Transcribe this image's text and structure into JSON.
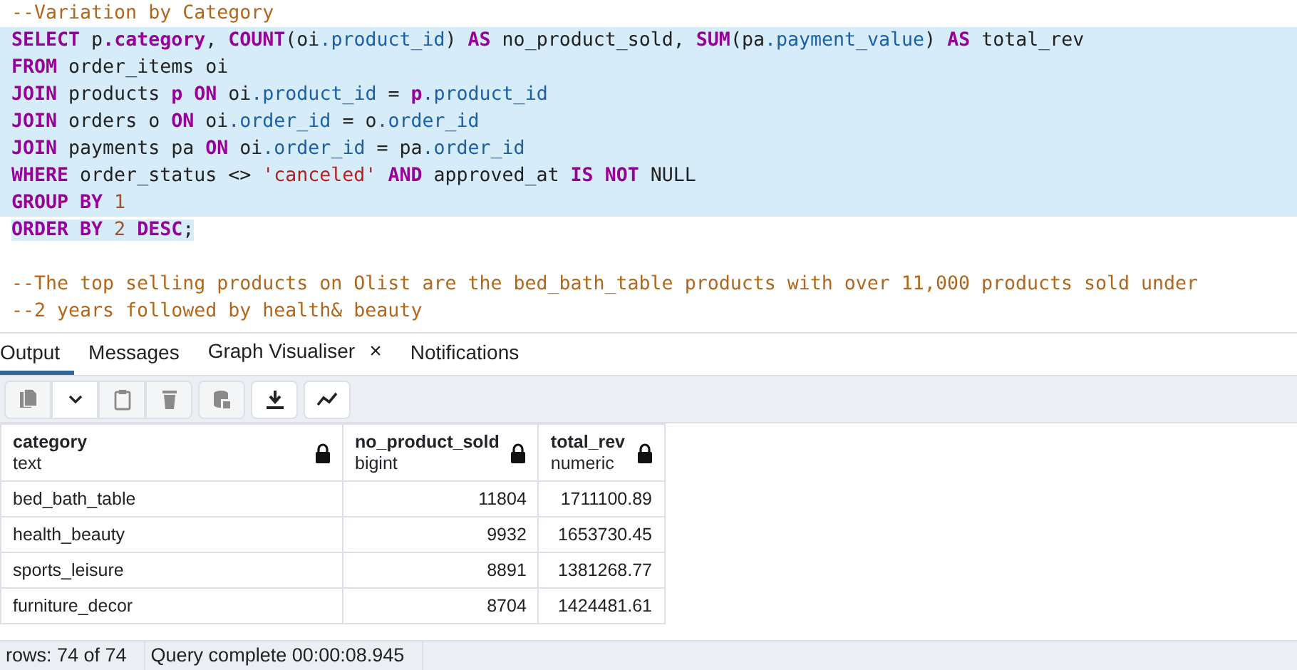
{
  "editor": {
    "lines": [
      {
        "selected": false,
        "tokens": [
          {
            "kind": "comment",
            "text": "--Variation by Category"
          }
        ]
      },
      {
        "selected": true,
        "tokens": [
          {
            "kind": "keyword",
            "text": "SELECT"
          },
          {
            "kind": "plain",
            "text": " p"
          },
          {
            "kind": "keyword",
            "text": ".category"
          },
          {
            "kind": "plain",
            "text": ", "
          },
          {
            "kind": "keyword",
            "text": "COUNT"
          },
          {
            "kind": "plain",
            "text": "(oi"
          },
          {
            "kind": "prop",
            "text": ".product_id"
          },
          {
            "kind": "plain",
            "text": ") "
          },
          {
            "kind": "keyword",
            "text": "AS"
          },
          {
            "kind": "plain",
            "text": " no_product_sold, "
          },
          {
            "kind": "keyword",
            "text": "SUM"
          },
          {
            "kind": "plain",
            "text": "(pa"
          },
          {
            "kind": "prop",
            "text": ".payment_value"
          },
          {
            "kind": "plain",
            "text": ") "
          },
          {
            "kind": "keyword",
            "text": "AS"
          },
          {
            "kind": "plain",
            "text": " total_rev"
          }
        ]
      },
      {
        "selected": true,
        "tokens": [
          {
            "kind": "keyword",
            "text": "FROM"
          },
          {
            "kind": "plain",
            "text": " order_items oi"
          }
        ]
      },
      {
        "selected": true,
        "tokens": [
          {
            "kind": "keyword",
            "text": "JOIN"
          },
          {
            "kind": "plain",
            "text": " products "
          },
          {
            "kind": "keyword",
            "text": "p ON"
          },
          {
            "kind": "plain",
            "text": " oi"
          },
          {
            "kind": "prop",
            "text": ".product_id"
          },
          {
            "kind": "plain",
            "text": " = "
          },
          {
            "kind": "keyword",
            "text": "p"
          },
          {
            "kind": "prop",
            "text": ".product_id"
          }
        ]
      },
      {
        "selected": true,
        "tokens": [
          {
            "kind": "keyword",
            "text": "JOIN"
          },
          {
            "kind": "plain",
            "text": " orders o "
          },
          {
            "kind": "keyword",
            "text": "ON"
          },
          {
            "kind": "plain",
            "text": " oi"
          },
          {
            "kind": "prop",
            "text": ".order_id"
          },
          {
            "kind": "plain",
            "text": " = o"
          },
          {
            "kind": "prop",
            "text": ".order_id"
          }
        ]
      },
      {
        "selected": true,
        "tokens": [
          {
            "kind": "keyword",
            "text": "JOIN"
          },
          {
            "kind": "plain",
            "text": " payments pa "
          },
          {
            "kind": "keyword",
            "text": "ON"
          },
          {
            "kind": "plain",
            "text": " oi"
          },
          {
            "kind": "prop",
            "text": ".order_id"
          },
          {
            "kind": "plain",
            "text": " = pa"
          },
          {
            "kind": "prop",
            "text": ".order_id"
          }
        ]
      },
      {
        "selected": true,
        "tokens": [
          {
            "kind": "keyword",
            "text": "WHERE"
          },
          {
            "kind": "plain",
            "text": " order_status <> "
          },
          {
            "kind": "string",
            "text": "'canceled'"
          },
          {
            "kind": "keyword",
            "text": " AND"
          },
          {
            "kind": "plain",
            "text": " approved_at "
          },
          {
            "kind": "keyword",
            "text": "IS NOT"
          },
          {
            "kind": "plain",
            "text": " NULL"
          }
        ]
      },
      {
        "selected": true,
        "tokens": [
          {
            "kind": "keyword",
            "text": "GROUP BY"
          },
          {
            "kind": "number",
            "text": " 1"
          }
        ]
      },
      {
        "selected": true,
        "tokens": [
          {
            "kind": "keyword",
            "text": "ORDER BY"
          },
          {
            "kind": "number",
            "text": " 2"
          },
          {
            "kind": "keyword",
            "text": " DESC"
          },
          {
            "kind": "plain",
            "text": ";"
          }
        ]
      },
      {
        "selected": false
      },
      {
        "selected": false,
        "tokens": [
          {
            "kind": "comment",
            "text": "--The top selling products on Olist are the bed_bath_table products with over 11,000 products sold under"
          }
        ]
      },
      {
        "selected": false,
        "tokens": [
          {
            "kind": "comment",
            "text": "--2 years followed by health& beauty"
          }
        ]
      }
    ]
  },
  "tabs": [
    {
      "label": "Output",
      "selected": true
    },
    {
      "label": "Messages",
      "selected": false
    },
    {
      "label": "Graph Visualiser",
      "selected": false,
      "close": "×"
    },
    {
      "label": "Notifications",
      "selected": false
    }
  ],
  "toolbar": [
    {
      "kind": "copy",
      "disabled": true
    },
    {
      "kind": "caret",
      "disabled": false
    },
    {
      "kind": "paste",
      "disabled": true
    },
    {
      "kind": "delete",
      "disabled": true
    },
    {
      "kind": "save-data",
      "disabled": true
    },
    {
      "kind": "download",
      "disabled": false
    },
    {
      "kind": "graph",
      "disabled": false
    }
  ],
  "table": {
    "columns": [
      {
        "name": "category",
        "type": "text",
        "kind": "text"
      },
      {
        "name": "no_product_sold",
        "type": "bigint",
        "kind": "number"
      },
      {
        "name": "total_rev",
        "type": "numeric",
        "kind": "number"
      }
    ],
    "rows": [
      [
        "bed_bath_table",
        "11804",
        "1711100.89"
      ],
      [
        "health_beauty",
        "9932",
        "1653730.45"
      ],
      [
        "sports_leisure",
        "8891",
        "1381268.77"
      ],
      [
        "furniture_decor",
        "8704",
        "1424481.61"
      ]
    ]
  },
  "status_bar": {
    "rows": "rows: 74 of 74",
    "query": "Query complete 00:00:08.945"
  }
}
